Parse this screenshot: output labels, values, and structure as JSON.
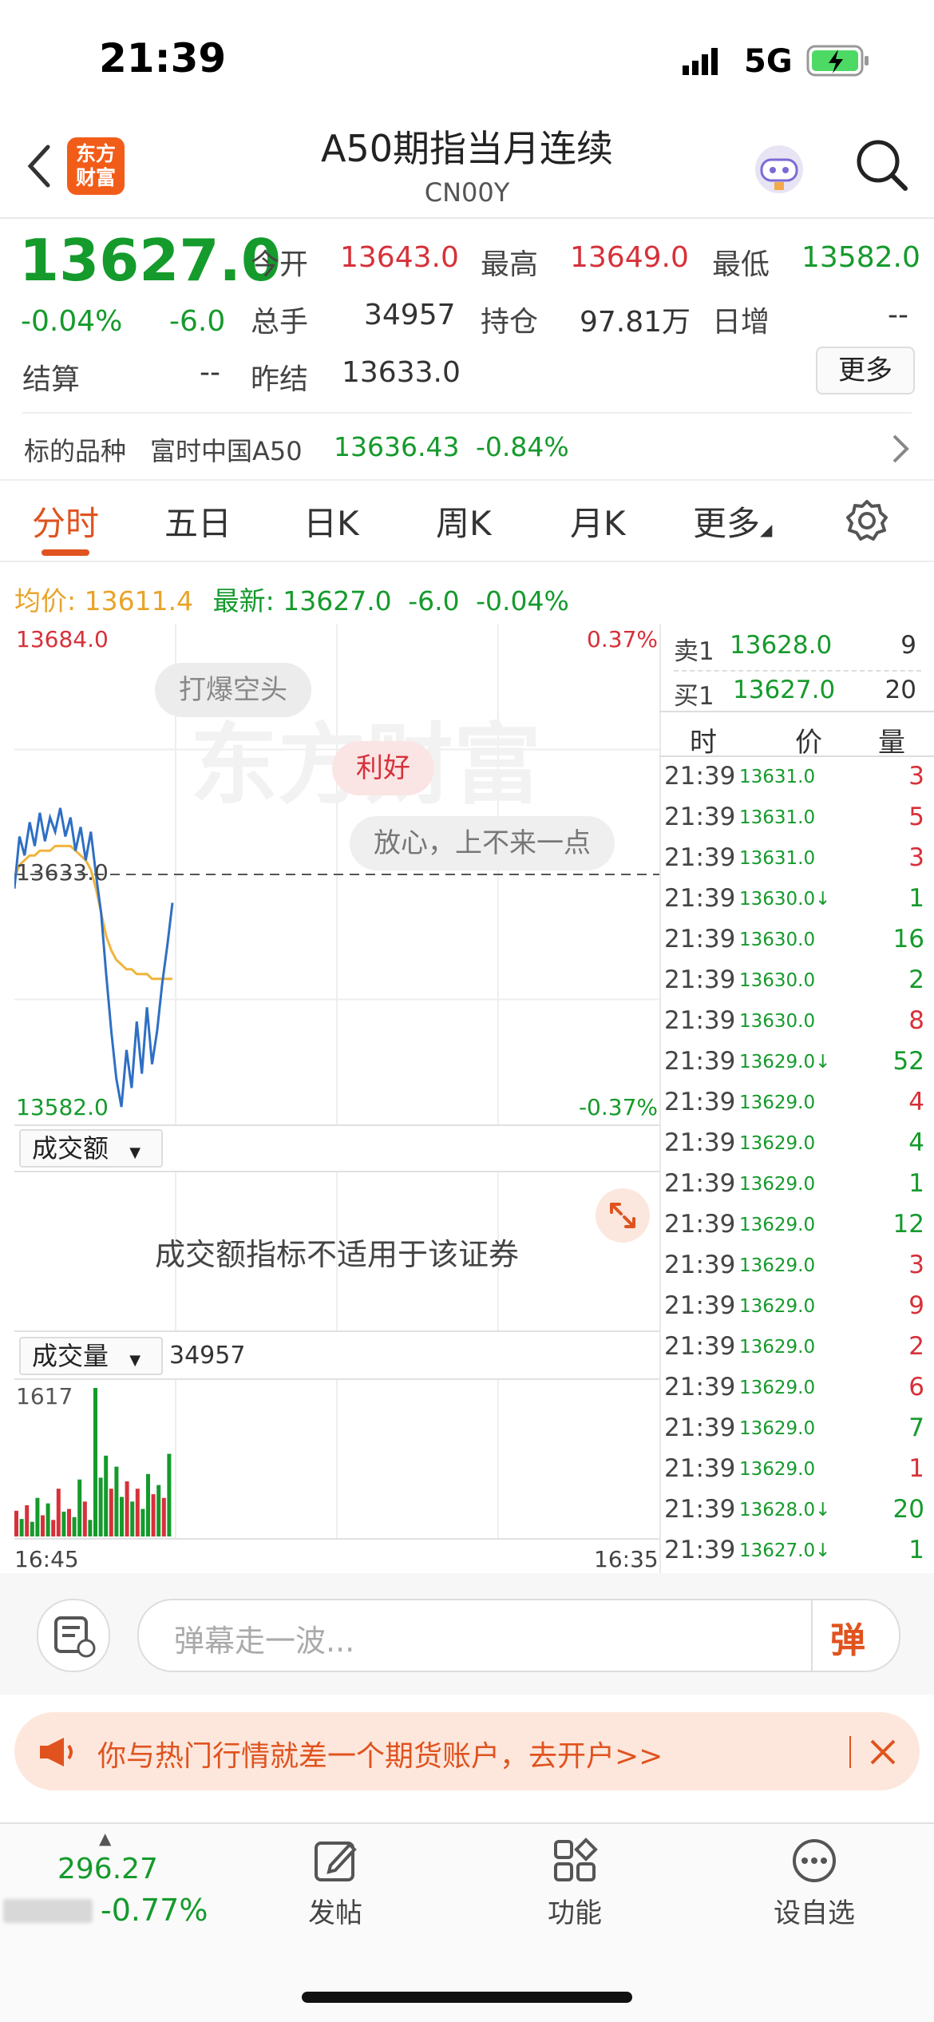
{
  "status_bar": {
    "time": "21:39",
    "network": "5G"
  },
  "header": {
    "title": "A50期指当月连续",
    "code": "CN00Y",
    "logo_text": "东方财富"
  },
  "quote": {
    "price": "13627.0",
    "change_pct": "-0.04%",
    "change": "-6.0",
    "open_label": "今开",
    "open": "13643.0",
    "high_label": "最高",
    "high": "13649.0",
    "low_label": "最低",
    "low": "13582.0",
    "volume_label": "总手",
    "volume": "34957",
    "oi_label": "持仓",
    "oi": "97.81万",
    "daily_inc_label": "日增",
    "daily_inc": "--",
    "settle_label": "结算",
    "settle": "--",
    "prev_settle_label": "昨结",
    "prev_settle": "13633.0",
    "more_button": "更多"
  },
  "underlying": {
    "label": "标的品种",
    "name": "富时中国A50",
    "price": "13636.43",
    "change": "-0.84%"
  },
  "tabs": [
    "分时",
    "五日",
    "日K",
    "周K",
    "月K",
    "更多"
  ],
  "chart_info": {
    "avg_label": "均价:",
    "avg": "13611.4",
    "latest_label": "最新:",
    "latest": "13627.0",
    "change": "-6.0",
    "pct": "-0.04%"
  },
  "bubbles": [
    "打爆空头",
    "利好",
    "放心，上不来一点"
  ],
  "watermark": "东方财富",
  "orderbook": {
    "ask_label": "卖1",
    "ask_price": "13628.0",
    "ask_vol": "9",
    "bid_label": "买1",
    "bid_price": "13627.0",
    "bid_vol": "20",
    "col_time": "时",
    "col_price": "价",
    "col_vol": "量"
  },
  "trades": [
    {
      "time": "21:39",
      "price": "13631.0",
      "vol": "3",
      "dir": "red"
    },
    {
      "time": "21:39",
      "price": "13631.0",
      "vol": "5",
      "dir": "red"
    },
    {
      "time": "21:39",
      "price": "13631.0",
      "vol": "3",
      "dir": "red"
    },
    {
      "time": "21:39",
      "price": "13630.0↓",
      "vol": "1",
      "dir": "green"
    },
    {
      "time": "21:39",
      "price": "13630.0",
      "vol": "16",
      "dir": "green"
    },
    {
      "time": "21:39",
      "price": "13630.0",
      "vol": "2",
      "dir": "green"
    },
    {
      "time": "21:39",
      "price": "13630.0",
      "vol": "8",
      "dir": "red"
    },
    {
      "time": "21:39",
      "price": "13629.0↓",
      "vol": "52",
      "dir": "green"
    },
    {
      "time": "21:39",
      "price": "13629.0",
      "vol": "4",
      "dir": "red"
    },
    {
      "time": "21:39",
      "price": "13629.0",
      "vol": "4",
      "dir": "green"
    },
    {
      "time": "21:39",
      "price": "13629.0",
      "vol": "1",
      "dir": "green"
    },
    {
      "time": "21:39",
      "price": "13629.0",
      "vol": "12",
      "dir": "green"
    },
    {
      "time": "21:39",
      "price": "13629.0",
      "vol": "3",
      "dir": "red"
    },
    {
      "time": "21:39",
      "price": "13629.0",
      "vol": "9",
      "dir": "red"
    },
    {
      "time": "21:39",
      "price": "13629.0",
      "vol": "2",
      "dir": "red"
    },
    {
      "time": "21:39",
      "price": "13629.0",
      "vol": "6",
      "dir": "red"
    },
    {
      "time": "21:39",
      "price": "13629.0",
      "vol": "7",
      "dir": "green"
    },
    {
      "time": "21:39",
      "price": "13629.0",
      "vol": "1",
      "dir": "red"
    },
    {
      "time": "21:39",
      "price": "13628.0↓",
      "vol": "20",
      "dir": "green"
    },
    {
      "time": "21:39",
      "price": "13627.0↓",
      "vol": "1",
      "dir": "green"
    }
  ],
  "turnover_panel": {
    "selector": "成交额",
    "message": "成交额指标不适用于该证券"
  },
  "volume_panel": {
    "selector": "成交量",
    "value": "34957",
    "max": "1617"
  },
  "chart_data": [
    {
      "type": "line",
      "y_axis_left": {
        "top": "13684.0",
        "bottom": "13582.0",
        "ref": "13633.0"
      },
      "y_axis_right": {
        "top": "0.37%",
        "bottom": "-0.37%"
      },
      "ylim": [
        13582,
        13684
      ],
      "reference_level": 13633,
      "series": [
        {
          "values": [
            13630,
            13641,
            13637,
            13644,
            13639,
            13646,
            13640,
            13645,
            13642,
            13647,
            13641,
            13645,
            13638,
            13643,
            13636,
            13642,
            13633,
            13625,
            13612,
            13600,
            13590,
            13584,
            13596,
            13588,
            13602,
            13591,
            13605,
            13593,
            13600,
            13610,
            13618,
            13627
          ]
        },
        {
          "values": [
            13632,
            13635,
            13636,
            13637,
            13637,
            13638,
            13638,
            13638,
            13639,
            13639,
            13639,
            13639,
            13638,
            13637,
            13636,
            13634,
            13630,
            13625,
            13620,
            13617,
            13615,
            13614,
            13613,
            13613,
            13612,
            13612,
            13612,
            13611,
            13611,
            13611,
            13611,
            13611
          ]
        }
      ]
    },
    {
      "type": "bar",
      "ylim": [
        0,
        1617
      ],
      "x_start": "16:45",
      "x_end": "16:35",
      "values": [
        280,
        190,
        340,
        160,
        420,
        230,
        360,
        180,
        520,
        270,
        300,
        210,
        620,
        380,
        180,
        1617,
        640,
        880,
        520,
        760,
        430,
        600,
        380,
        520,
        300,
        680,
        460,
        560,
        420,
        900
      ],
      "colors": [
        "red",
        "green",
        "red",
        "green",
        "green",
        "red",
        "green",
        "red",
        "red",
        "green",
        "red",
        "green",
        "green",
        "red",
        "green",
        "green",
        "green",
        "green",
        "red",
        "green",
        "green",
        "red",
        "green",
        "red",
        "green",
        "green",
        "red",
        "green",
        "red",
        "green"
      ]
    }
  ],
  "danmu": {
    "placeholder": "弹幕走一波...",
    "button": "弹"
  },
  "promo": {
    "text": "你与热门行情就差一个期货账户，去开户>>"
  },
  "bottom_nav": {
    "index_value": "296.27",
    "index_change": "-0.77%",
    "post": "发帖",
    "func": "功能",
    "watch": "设自选"
  }
}
